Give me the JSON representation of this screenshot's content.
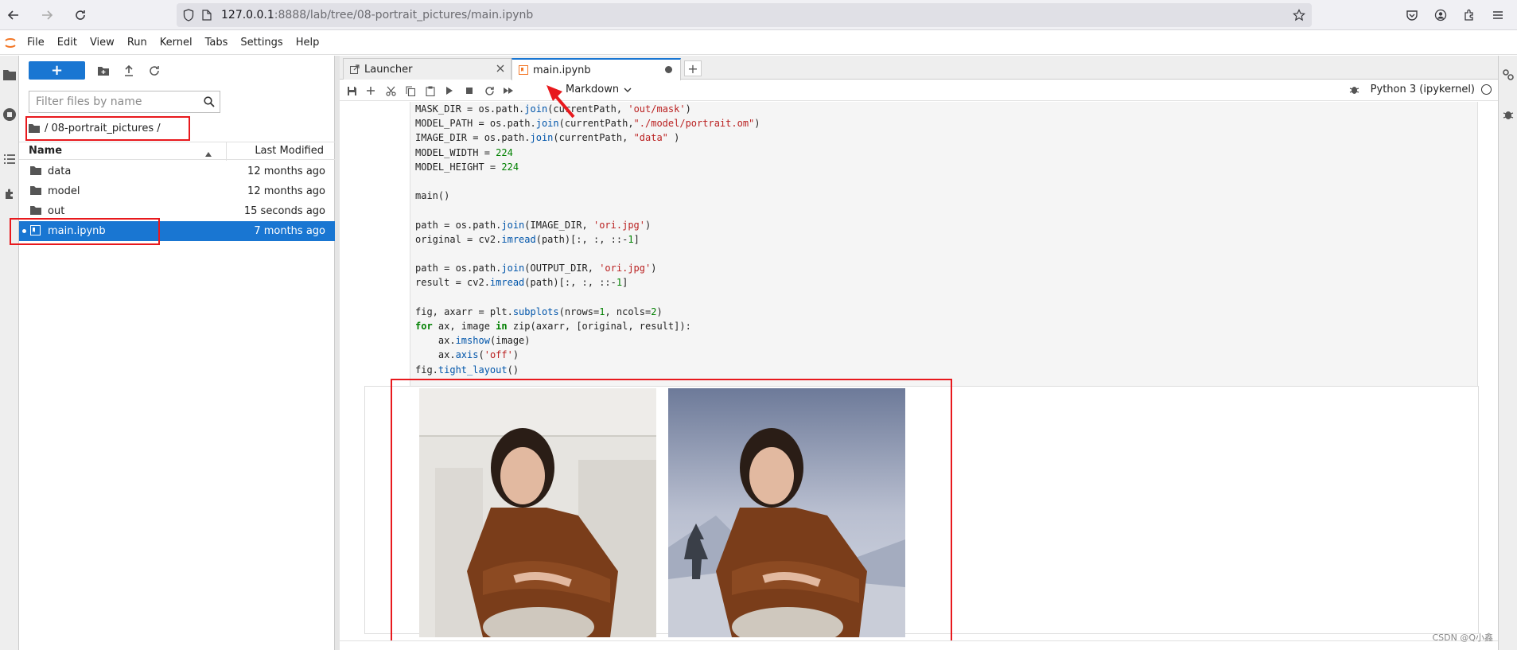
{
  "browser": {
    "url_host": "127.0.0.1",
    "url_rest": ":8888/lab/tree/08-portrait_pictures/main.ipynb"
  },
  "menu": [
    "File",
    "Edit",
    "View",
    "Run",
    "Kernel",
    "Tabs",
    "Settings",
    "Help"
  ],
  "filebrowser": {
    "new_label": "+",
    "filter_placeholder": "Filter files by name",
    "breadcrumb": "/ 08-portrait_pictures /",
    "col_name": "Name",
    "col_modified": "Last Modified",
    "files": [
      {
        "name": "data",
        "modified": "12 months ago",
        "type": "folder"
      },
      {
        "name": "model",
        "modified": "12 months ago",
        "type": "folder"
      },
      {
        "name": "out",
        "modified": "15 seconds ago",
        "type": "folder"
      },
      {
        "name": "main.ipynb",
        "modified": "7 months ago",
        "type": "notebook"
      }
    ]
  },
  "tabs": [
    {
      "label": "Launcher"
    },
    {
      "label": "main.ipynb"
    }
  ],
  "toolbar": {
    "cell_type": "Markdown",
    "kernel_name": "Python 3 (ipykernel)"
  },
  "watermark": "CSDN @Q小鑫",
  "colors": {
    "accent": "#1976d2",
    "highlight": "#e8191d"
  }
}
